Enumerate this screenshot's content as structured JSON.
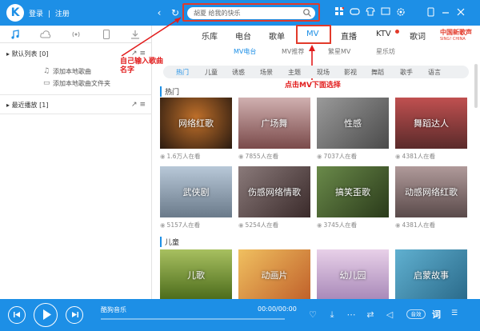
{
  "header": {
    "logo": "K",
    "login": "登录",
    "divider": "|",
    "register": "注册",
    "back_glyph": "‹",
    "refresh_glyph": "↻",
    "search_value": "胡夏 给我的快乐"
  },
  "annotations": {
    "search_hint": "自己输入歌曲名字",
    "mv_hint": "点击MV下面选择"
  },
  "sidebar": {
    "default_list": {
      "title": "默认列表",
      "count": "[0]"
    },
    "add_local": "添加本地歌曲",
    "add_folder": "添加本地歌曲文件夹",
    "recent": {
      "title": "最近播放",
      "count": "[1]"
    }
  },
  "main_nav": [
    "乐库",
    "电台",
    "歌单",
    "MV",
    "直播",
    "KTV",
    "歌词"
  ],
  "brand": {
    "line1": "中国新歌声",
    "line2": "SING! CHINA"
  },
  "sub_tabs": [
    "MV电台",
    "MV推荐",
    "繁星MV",
    "星乐坊"
  ],
  "categories": [
    "热门",
    "儿童",
    "诱惑",
    "场景",
    "主题",
    "现场",
    "影视",
    "舞蹈",
    "歌手",
    "语言"
  ],
  "sections": [
    {
      "title": "热门",
      "cards": [
        {
          "label": "网络红歌",
          "viewers": "1.6万人在看",
          "color": "#3a2a20"
        },
        {
          "label": "广场舞",
          "viewers": "7855人在看",
          "color": "#9a6a6a"
        },
        {
          "label": "性感",
          "viewers": "7037人在看",
          "color": "#6a6a6a"
        },
        {
          "label": "舞蹈达人",
          "viewers": "4381人在看",
          "color": "#8a3a3a"
        },
        {
          "label": "武侠剧",
          "viewers": "5157人在看",
          "color": "#7a8a9a"
        },
        {
          "label": "伤感网络情歌",
          "viewers": "5254人在看",
          "color": "#6a5a5a"
        },
        {
          "label": "搞笑歪歌",
          "viewers": "3745人在看",
          "color": "#4a5a3a"
        },
        {
          "label": "动感网络红歌",
          "viewers": "4381人在看",
          "color": "#7a6a6a"
        }
      ]
    },
    {
      "title": "儿童",
      "cards": [
        {
          "label": "儿歌",
          "viewers": "",
          "color": "#6a8a2a"
        },
        {
          "label": "动画片",
          "viewers": "",
          "color": "#c08a3a"
        },
        {
          "label": "幼儿园",
          "viewers": "",
          "color": "#c8a8c8"
        },
        {
          "label": "启蒙故事",
          "viewers": "",
          "color": "#3a8aa8"
        }
      ]
    }
  ],
  "player": {
    "song": "酷狗音乐",
    "time": "00:00/00:00",
    "quality": "音效",
    "lyric": "词"
  },
  "colors": {
    "brand_blue": "#1d8fe6",
    "annotation_red": "#e23a2a"
  }
}
